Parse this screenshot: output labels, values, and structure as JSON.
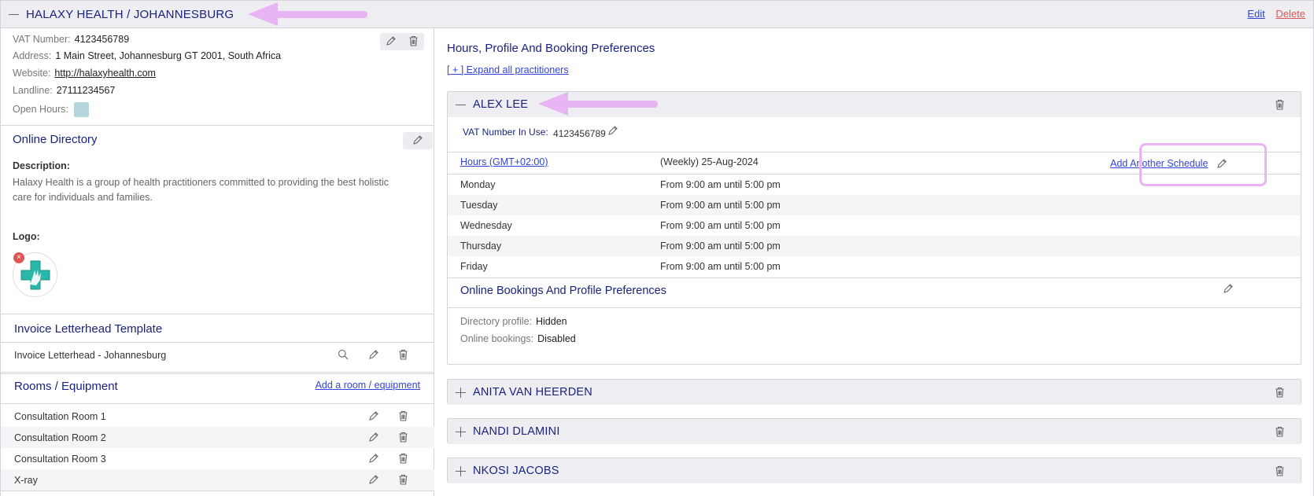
{
  "header": {
    "title": "HALAXY HEALTH / JOHANNESBURG",
    "edit_label": "Edit",
    "delete_label": "Delete"
  },
  "clinic": {
    "vat": {
      "label": "VAT Number:",
      "value": "4123456789"
    },
    "address": {
      "label": "Address:",
      "value": "1 Main Street, Johannesburg GT 2001, South Africa"
    },
    "website": {
      "label": "Website:",
      "value": "http://halaxyhealth.com"
    },
    "landline": {
      "label": "Landline:",
      "value": "27111234567"
    },
    "open_hours": {
      "label": "Open Hours:"
    }
  },
  "online_directory": {
    "title": "Online Directory",
    "description_label": "Description:",
    "description_line1": "Halaxy Health is a group of health practitioners committed to providing the best holistic",
    "description_line2": "care for individuals and families.",
    "logo_label": "Logo:"
  },
  "invoice": {
    "title": "Invoice Letterhead Template",
    "item": "Invoice Letterhead - Johannesburg"
  },
  "rooms": {
    "title": "Rooms / Equipment",
    "add_label": "Add a room / equipment",
    "items": [
      "Consultation Room 1",
      "Consultation Room 2",
      "Consultation Room 3",
      "X-ray"
    ]
  },
  "preferences": {
    "title": "Hours, Profile And Booking Preferences",
    "expand_label": "[ + ] Expand all practitioners"
  },
  "practitioner": {
    "name": "ALEX LEE",
    "vat_label": "VAT Number In Use:",
    "vat_value": "4123456789",
    "hours_link": "Hours (GMT+02:00)",
    "schedule": "(Weekly) 25-Aug-2024",
    "add_schedule": "Add Another Schedule",
    "days": [
      {
        "day": "Monday",
        "time": "From 9:00 am until 5:00 pm"
      },
      {
        "day": "Tuesday",
        "time": "From 9:00 am until 5:00 pm"
      },
      {
        "day": "Wednesday",
        "time": "From 9:00 am until 5:00 pm"
      },
      {
        "day": "Thursday",
        "time": "From 9:00 am until 5:00 pm"
      },
      {
        "day": "Friday",
        "time": "From 9:00 am until 5:00 pm"
      }
    ],
    "bookings_title": "Online Bookings And Profile Preferences",
    "directory_profile": {
      "label": "Directory profile:",
      "value": "Hidden"
    },
    "online_bookings": {
      "label": "Online bookings:",
      "value": "Disabled"
    }
  },
  "collapsed_practitioners": [
    "ANITA VAN HEERDEN",
    "NANDI DLAMINI",
    "NKOSI JACOBS"
  ],
  "colors": {
    "navy": "#1a237e",
    "link": "#3344dd",
    "delete": "#e05656",
    "highlight": "#e8b4f3"
  }
}
